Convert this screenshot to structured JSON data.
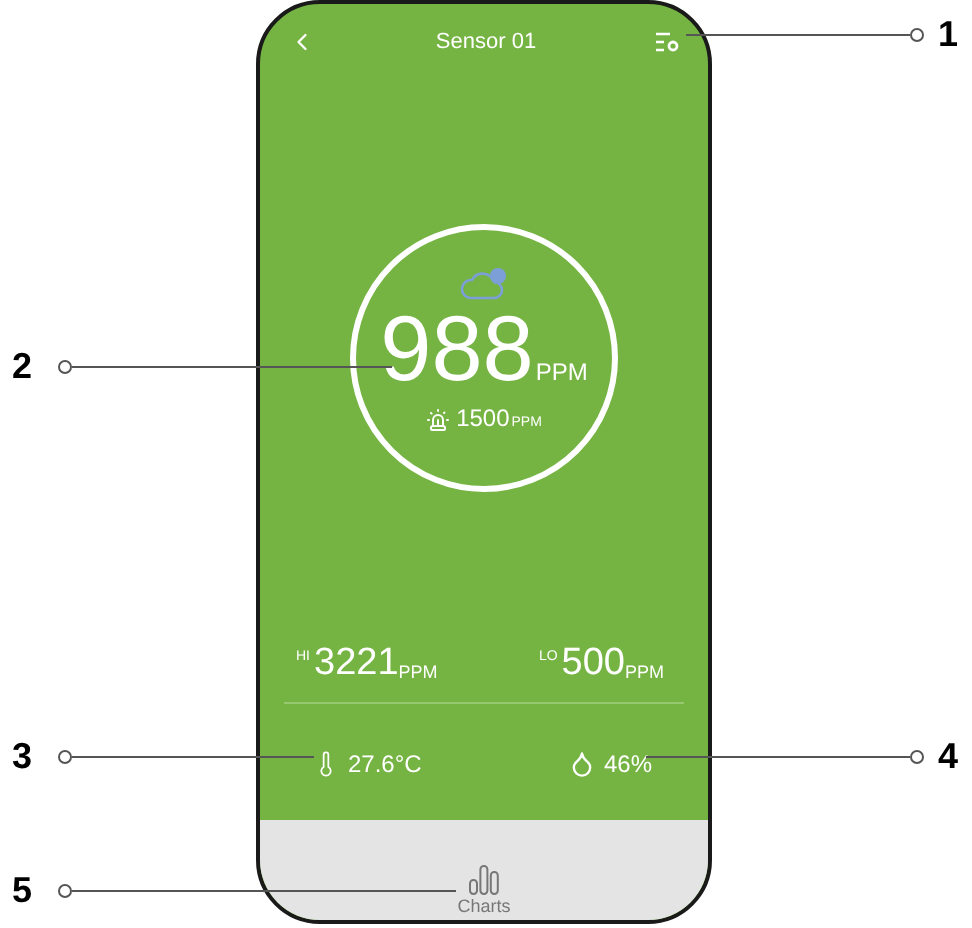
{
  "header": {
    "title": "Sensor 01"
  },
  "reading": {
    "value": "988",
    "unit": "PPM",
    "alarm_value": "1500",
    "alarm_unit": "PPM"
  },
  "extremes": [
    {
      "kind": "high",
      "label": "HI",
      "value": "3221",
      "unit": "PPM"
    },
    {
      "kind": "low",
      "label": "LO",
      "value": "500",
      "unit": "PPM"
    }
  ],
  "climate": [
    {
      "kind": "temperature",
      "value": "27.6°C"
    },
    {
      "kind": "humidity",
      "value": "46%"
    }
  ],
  "nav": [
    {
      "label": "Charts"
    }
  ],
  "callouts": [
    "1",
    "2",
    "3",
    "4",
    "5"
  ]
}
